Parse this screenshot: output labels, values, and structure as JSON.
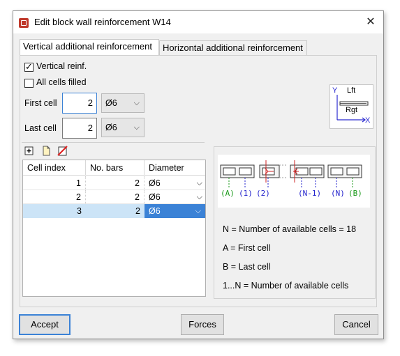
{
  "window": {
    "title": "Edit block wall reinforcement W14"
  },
  "tabs": [
    {
      "label": "Vertical additional reinforcement"
    },
    {
      "label": "Horizontal additional reinforcement"
    }
  ],
  "options": {
    "vertical_reinf_label": "Vertical reinf.",
    "vertical_reinf_checked": true,
    "all_cells_filled_label": "All cells filled",
    "all_cells_filled_checked": false
  },
  "first_cell": {
    "label": "First cell",
    "value": "2",
    "diameter": "Ø6"
  },
  "last_cell": {
    "label": "Last cell",
    "value": "2",
    "diameter": "Ø6"
  },
  "axis_diagram": {
    "y_label": "Y",
    "x_label": "X",
    "top_label": "Lft",
    "bottom_label": "Rgt"
  },
  "table": {
    "columns": [
      "Cell index",
      "No. bars",
      "Diameter"
    ],
    "rows": [
      {
        "index": "1",
        "bars": "2",
        "diameter": "Ø6"
      },
      {
        "index": "2",
        "bars": "2",
        "diameter": "Ø6"
      },
      {
        "index": "3",
        "bars": "2",
        "diameter": "Ø6"
      }
    ],
    "selected_row": 2
  },
  "cell_diagram": {
    "labels": [
      "(A)",
      "(1)",
      "(2)",
      "(N-1)",
      "(N)",
      "(B)"
    ],
    "colors": {
      "green": "#1a9a1a",
      "blue": "#2222cc",
      "red": "#cc2222"
    }
  },
  "legend": {
    "n_line": "N = Number of available cells = 18",
    "a_line": "A = First cell",
    "b_line": "B = Last cell",
    "range_line": "1...N = Number of available cells"
  },
  "buttons": {
    "accept": "Accept",
    "forces": "Forces",
    "cancel": "Cancel"
  }
}
